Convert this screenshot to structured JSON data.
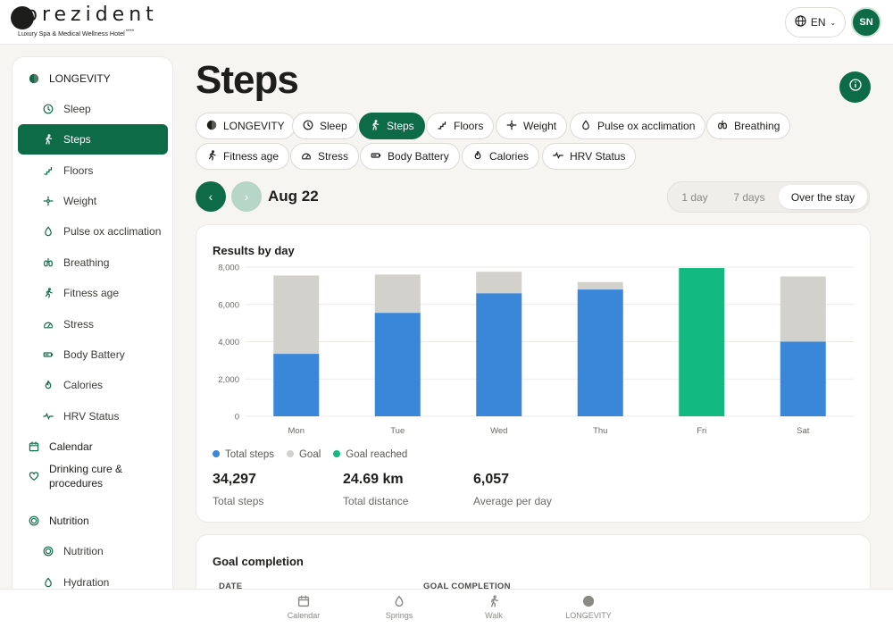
{
  "brand": {
    "name": "prezident",
    "tagline": "Luxury Spa & Medical Wellness Hotel",
    "stars": "****"
  },
  "header": {
    "language": "EN",
    "avatar_initials": "SN"
  },
  "sidebar": {
    "items": [
      {
        "label": "LONGEVITY",
        "icon": "longevity-icon",
        "level": "top"
      },
      {
        "label": "Sleep",
        "icon": "clock-icon",
        "level": "sub"
      },
      {
        "label": "Steps",
        "icon": "walk-icon",
        "level": "sub",
        "active": true
      },
      {
        "label": "Floors",
        "icon": "stairs-icon",
        "level": "sub"
      },
      {
        "label": "Weight",
        "icon": "weight-icon",
        "level": "sub"
      },
      {
        "label": "Pulse ox acclimation",
        "icon": "drop-icon",
        "level": "sub"
      },
      {
        "label": "Breathing",
        "icon": "lungs-icon",
        "level": "sub"
      },
      {
        "label": "Fitness age",
        "icon": "run-icon",
        "level": "sub"
      },
      {
        "label": "Stress",
        "icon": "gauge-icon",
        "level": "sub"
      },
      {
        "label": "Body Battery",
        "icon": "battery-icon",
        "level": "sub"
      },
      {
        "label": "Calories",
        "icon": "flame-icon",
        "level": "sub"
      },
      {
        "label": "HRV Status",
        "icon": "pulse-icon",
        "level": "sub"
      },
      {
        "label": "Calendar",
        "icon": "calendar-icon",
        "level": "top"
      },
      {
        "label": "Drinking cure & procedures",
        "icon": "heart-icon",
        "level": "top"
      },
      {
        "label": "Nutrition",
        "icon": "nutrition-icon",
        "level": "top"
      },
      {
        "label": "Nutrition",
        "icon": "nutrition-icon",
        "level": "sub"
      },
      {
        "label": "Hydration",
        "icon": "drop-icon",
        "level": "sub"
      }
    ]
  },
  "main": {
    "title": "Steps",
    "chips": [
      {
        "label": "LONGEVITY",
        "icon": "longevity-icon"
      },
      {
        "label": "Sleep",
        "icon": "clock-icon"
      },
      {
        "label": "Steps",
        "icon": "walk-icon",
        "active": true
      },
      {
        "label": "Floors",
        "icon": "stairs-icon"
      },
      {
        "label": "Weight",
        "icon": "weight-icon"
      },
      {
        "label": "Pulse ox acclimation",
        "icon": "drop-icon"
      },
      {
        "label": "Breathing",
        "icon": "lungs-icon"
      },
      {
        "label": "Fitness age",
        "icon": "run-icon"
      },
      {
        "label": "Stress",
        "icon": "gauge-icon"
      },
      {
        "label": "Body Battery",
        "icon": "battery-icon"
      },
      {
        "label": "Calories",
        "icon": "flame-icon"
      },
      {
        "label": "HRV Status",
        "icon": "pulse-icon"
      }
    ],
    "date": "Aug 22",
    "range_options": [
      "1 day",
      "7 days",
      "Over the stay"
    ],
    "range_selected": "Over the stay"
  },
  "results_card": {
    "title": "Results by day",
    "legend": [
      "Total steps",
      "Goal",
      "Goal reached"
    ],
    "stats": [
      {
        "value": "34,297",
        "label": "Total steps"
      },
      {
        "value": "24.69 km",
        "label": "Total distance"
      },
      {
        "value": "6,057",
        "label": "Average per day"
      }
    ]
  },
  "chart_data": {
    "type": "bar",
    "stacked": true,
    "categories": [
      "Mon",
      "Tue",
      "Wed",
      "Thu",
      "Fri",
      "Sat"
    ],
    "series": [
      {
        "name": "Total steps",
        "values": [
          3350,
          5550,
          6600,
          6800,
          0,
          4000
        ],
        "color": "#3a86d9"
      },
      {
        "name": "Goal",
        "values": [
          4200,
          2050,
          1150,
          400,
          0,
          3500
        ],
        "color": "#d3d1cb"
      },
      {
        "name": "Goal reached",
        "values": [
          0,
          0,
          0,
          0,
          7950,
          0
        ],
        "color": "#12b981"
      }
    ],
    "yticks": [
      "0",
      "2,000",
      "4,000",
      "6,000",
      "8,000"
    ],
    "ylim": [
      0,
      8000
    ],
    "grid": true,
    "legend_position": "bottom-left"
  },
  "goal_card": {
    "title": "Goal completion",
    "columns": [
      "DATE",
      "GOAL COMPLETION"
    ]
  },
  "bottom_nav": [
    {
      "label": "Calendar",
      "icon": "calendar-icon"
    },
    {
      "label": "Springs",
      "icon": "drop-icon"
    },
    {
      "label": "Walk",
      "icon": "walk-icon"
    },
    {
      "label": "LONGEVITY",
      "icon": "longevity-icon"
    }
  ],
  "colors": {
    "brand_green": "#0d6b47",
    "steps_blue": "#3a86d9",
    "goal_gray": "#d3d1cb",
    "reached_green": "#12b981"
  }
}
